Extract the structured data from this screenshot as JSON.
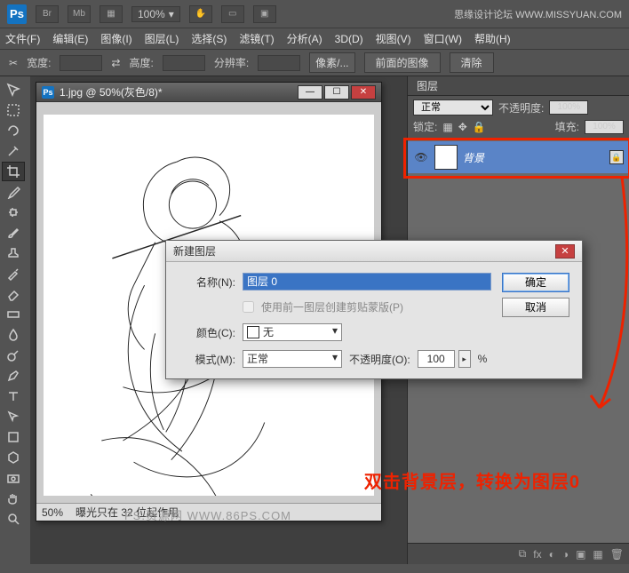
{
  "top": {
    "ps": "Ps",
    "br": "Br",
    "mb": "Mb",
    "zoom": "100%",
    "forum": "思缘设计论坛  WWW.MISSYUAN.COM"
  },
  "menu": {
    "file": "文件(F)",
    "edit": "编辑(E)",
    "image": "图像(I)",
    "layer": "图层(L)",
    "select": "选择(S)",
    "filter": "滤镜(T)",
    "analysis": "分析(A)",
    "threeD": "3D(D)",
    "view": "视图(V)",
    "window": "窗口(W)",
    "help": "帮助(H)"
  },
  "options": {
    "width": "宽度:",
    "height": "高度:",
    "res": "分辨率:",
    "unit": "像素/...",
    "front": "前面的图像",
    "clear": "清除"
  },
  "doc": {
    "title": "1.jpg @ 50%(灰色/8)*",
    "zoom": "50%",
    "status": "曝光只在 32 位起作用",
    "watermark": "PS.资源网  WWW.86PS.COM"
  },
  "panel": {
    "tab": "图层",
    "blend": "正常",
    "opacityLabel": "不透明度:",
    "opacity": "100%",
    "lockLabel": "锁定:",
    "fillLabel": "填充:",
    "fill": "100%",
    "layer": {
      "name": "背景"
    }
  },
  "dialog": {
    "title": "新建图层",
    "nameLabel": "名称(N):",
    "nameValue": "图层 0",
    "clipLabel": "使用前一图层创建剪贴蒙版(P)",
    "colorLabel": "颜色(C):",
    "colorValue": "无",
    "modeLabel": "模式(M):",
    "modeValue": "正常",
    "opLabel": "不透明度(O):",
    "opValue": "100",
    "opPct": "%",
    "ok": "确定",
    "cancel": "取消"
  },
  "annotation": "双击背景层，转换为图层0"
}
